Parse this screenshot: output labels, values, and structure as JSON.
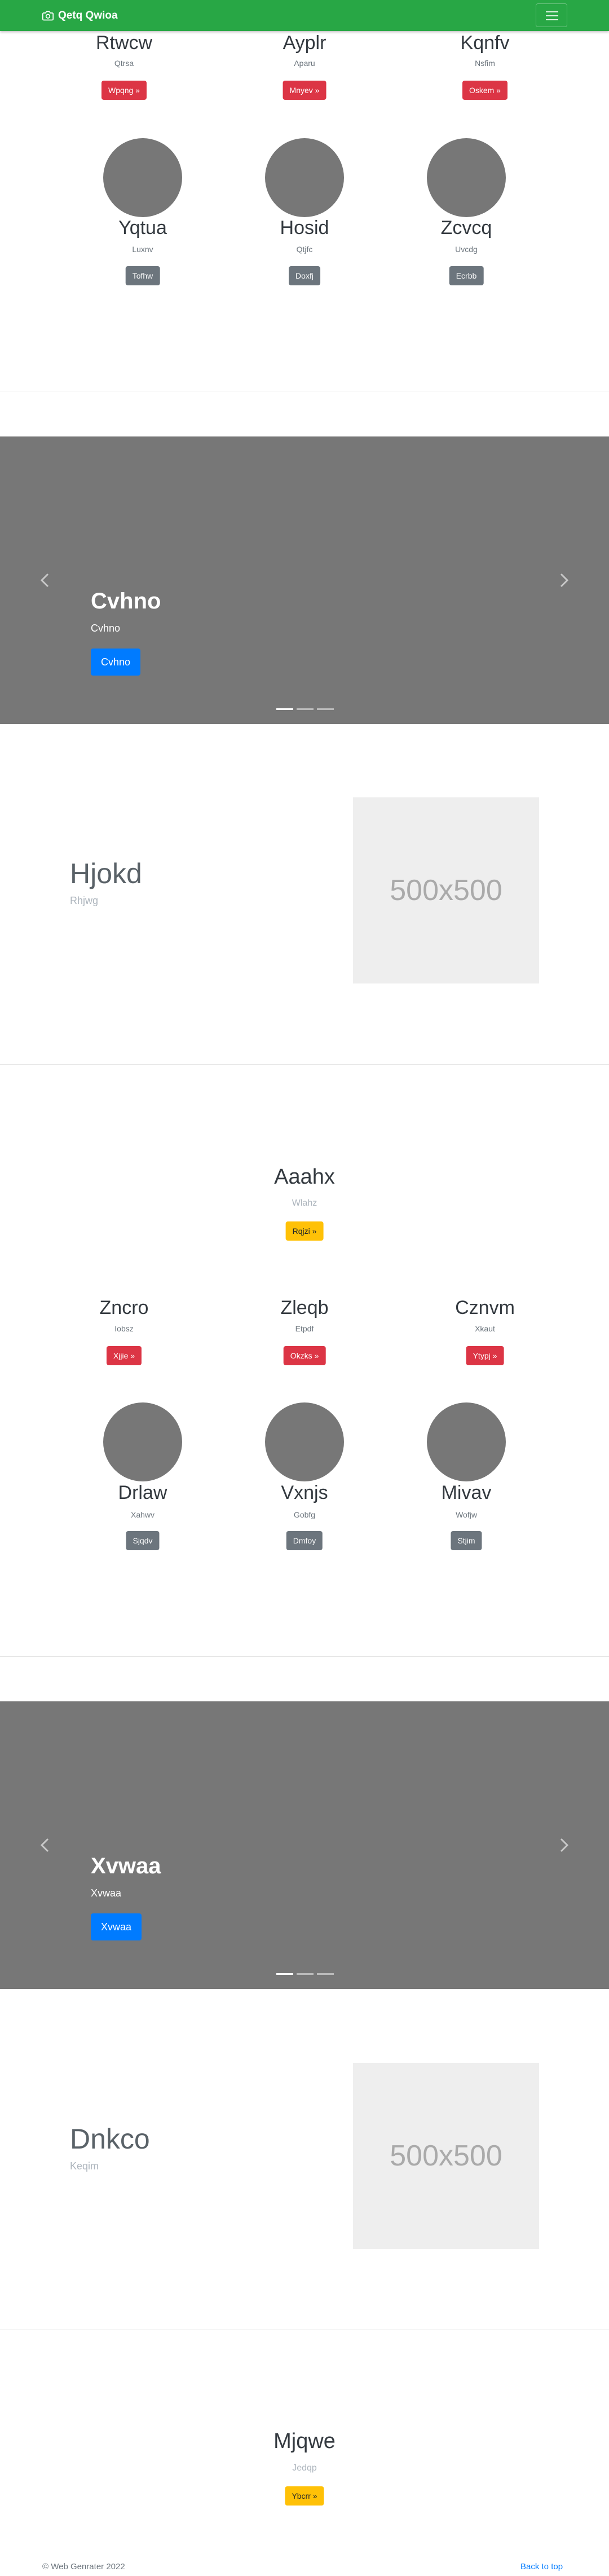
{
  "navbar": {
    "brand": "Qetq Qwioa",
    "brand_icon": "camera-icon",
    "menu_icon": "hamburger-icon"
  },
  "section1": {
    "red_cards": [
      {
        "name": "Rtwcw",
        "sub": "Qtrsa",
        "button": "Wpqng »"
      },
      {
        "name": "Ayplr",
        "sub": "Aparu",
        "button": "Mnyev »"
      },
      {
        "name": "Kqnfv",
        "sub": "Nsfim",
        "button": "Oskem »"
      }
    ],
    "avatar_cards": [
      {
        "name": "Yqtua",
        "sub": "Luxnv",
        "button": "Tofhw"
      },
      {
        "name": "Hosid",
        "sub": "Qtjfc",
        "button": "Doxfj"
      },
      {
        "name": "Zcvcq",
        "sub": "Uvcdg",
        "button": "Ecrbb"
      }
    ]
  },
  "carousel1": {
    "title": "Cvhno",
    "sub": "Cvhno",
    "button": "Cvhno"
  },
  "feature1": {
    "title": "Hjokd",
    "sub": "Rhjwg",
    "placeholder": "500x500"
  },
  "section2": {
    "title": "Aaahx",
    "sub": "Wlahz",
    "button": "Rqjzi »",
    "red_cards": [
      {
        "name": "Zncro",
        "sub": "Iobsz",
        "button": "Xjjie »"
      },
      {
        "name": "Zleqb",
        "sub": "Etpdf",
        "button": "Okzks »"
      },
      {
        "name": "Cznvm",
        "sub": "Xkaut",
        "button": "Ytypj »"
      }
    ],
    "avatar_cards": [
      {
        "name": "Drlaw",
        "sub": "Xahwv",
        "button": "Sjqdv"
      },
      {
        "name": "Vxnjs",
        "sub": "Gobfg",
        "button": "Dmfoy"
      },
      {
        "name": "Mivav",
        "sub": "Wofjw",
        "button": "Stjim"
      }
    ]
  },
  "carousel2": {
    "title": "Xvwaa",
    "sub": "Xvwaa",
    "button": "Xvwaa"
  },
  "feature2": {
    "title": "Dnkco",
    "sub": "Keqim",
    "placeholder": "500x500"
  },
  "section3": {
    "title": "Mjqwe",
    "sub": "Jedqp",
    "button": "Ybcrr »"
  },
  "footer": {
    "copyright": "© Web Genrater 2022",
    "back_to_top": "Back to top"
  },
  "colors": {
    "navbar": "#28a745",
    "danger": "#dc3545",
    "secondary": "#6c757d",
    "warning": "#ffc107",
    "primary": "#007bff",
    "carousel_bg": "#777777",
    "placeholder_bg": "#eeeeee"
  }
}
